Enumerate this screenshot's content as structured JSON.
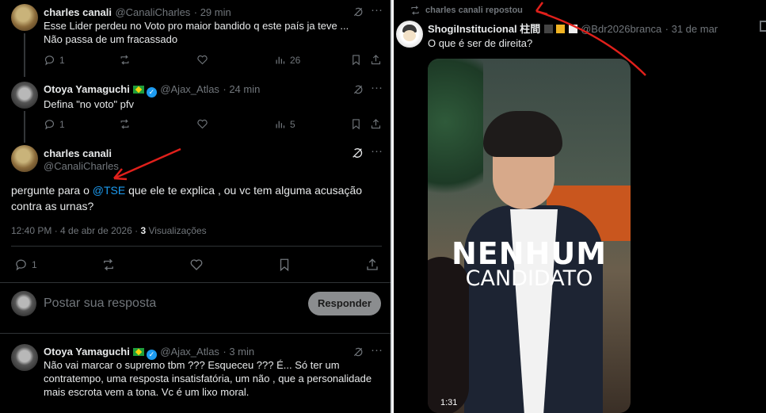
{
  "left": {
    "tweet1": {
      "name": "charles canali",
      "handle": "@CanaliCharles",
      "time": "· 29 min",
      "text_line1": "Esse Lider perdeu no Voto pro maior bandido q este país ja teve ...",
      "text_line2": "Não passa de um fracassado",
      "replies": "1",
      "views": "26"
    },
    "tweet2": {
      "name": "Otoya Yamaguchi",
      "handle": "@Ajax_Atlas",
      "time": "· 24 min",
      "text": "Defina \"no voto\" pfv",
      "replies": "1",
      "views": "5"
    },
    "main": {
      "name": "charles canali",
      "handle": "@CanaliCharles",
      "text_before": "pergunte para o ",
      "mention": "@TSE",
      "text_after": " que ele te explica , ou vc tem alguma acusação",
      "text_line2": "contra as urnas?",
      "timestamp": "12:40 PM · 4 de abr de 2026 · ",
      "views_count": "3",
      "views_label": " Visualizações",
      "replies": "1"
    },
    "compose": {
      "placeholder": "Postar sua resposta",
      "button": "Responder"
    },
    "tweet3": {
      "name": "Otoya Yamaguchi",
      "handle": "@Ajax_Atlas",
      "time": "· 3 min",
      "line1": "Não vai marcar o supremo tbm ??? Esqueceu ??? É... Só ter um",
      "line2": "contratempo, uma resposta insatisfatória, um não , que a personalidade",
      "line3": "mais escrota vem a tona. Vc é um lixo moral."
    }
  },
  "right": {
    "repost_label": "charles canali repostou",
    "name": "ShogiInstitucional 柱間",
    "handle": "@Bdr2026branca",
    "time": "· 31 de mar",
    "text": "O que é ser de direita?",
    "overlay_line1": "NENHUM",
    "overlay_line2": "CANDIDATO",
    "video_time": "1:31"
  },
  "colors": {
    "background": "#000000",
    "text": "#e7e9ea",
    "muted": "#71767b",
    "link": "#1d9bf0",
    "annotation_red": "#e0201b"
  }
}
